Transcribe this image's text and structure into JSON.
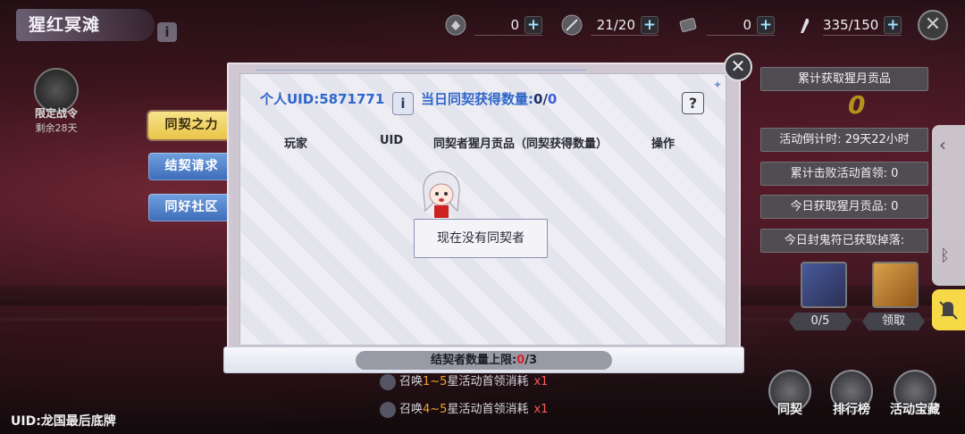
{
  "header": {
    "zone_title": "猩红冥滩",
    "info_icon_label": "i",
    "resources": [
      {
        "icon": "scroll-icon",
        "value": "0",
        "plus": "+"
      },
      {
        "icon": "feather-icon",
        "value": "21/20",
        "plus": "+"
      },
      {
        "icon": "ticket-icon",
        "value": "0",
        "plus": "+"
      },
      {
        "icon": "stamina-icon",
        "value": "335/150",
        "plus": "+"
      }
    ],
    "close_label": "✕"
  },
  "season": {
    "line1": "限定战令",
    "line2": "剩余28天"
  },
  "side_menu": [
    {
      "label": "同契之力",
      "active": true
    },
    {
      "label": "结契请求",
      "active": false
    },
    {
      "label": "同好社区",
      "active": false
    }
  ],
  "dialog": {
    "close_label": "✕",
    "uid_text": "个人UID:5871771",
    "info_label": "i",
    "daily_text": "当日同契获得数量:",
    "daily_current": "0",
    "daily_sep": "/",
    "daily_max": "0",
    "help_label": "?",
    "columns": [
      "玩家",
      "UID",
      "同契者猩月贡品（同契获得数量）",
      "操作"
    ],
    "empty_text": "现在没有同契者",
    "limit_prefix": "结契者数量上限:",
    "limit_current": "0",
    "limit_suffix": "/3"
  },
  "cost_lines": [
    {
      "prefix": "召唤",
      "range": "1~5",
      "suffix": "星活动首领消耗",
      "mult": "x1"
    },
    {
      "prefix": "召唤",
      "range": "4~5",
      "suffix": "星活动首领消耗",
      "mult": "x1"
    }
  ],
  "uid_footer": "UID:龙国最后底牌",
  "right_panel": {
    "bars": [
      "累计获取猩月贡品",
      "活动倒计时: 29天22小时",
      "累计击败活动首领: 0",
      "今日获取猩月贡品: 0",
      "今日封鬼符已获取掉落:"
    ],
    "big_value": "0",
    "slot_a_label": "0/5",
    "slot_b_label": "领取"
  },
  "bottom_nav": [
    "同契",
    "排行榜",
    "活动宝藏"
  ],
  "system": {
    "chevron": "‹",
    "bluetooth": "ᛒ"
  }
}
